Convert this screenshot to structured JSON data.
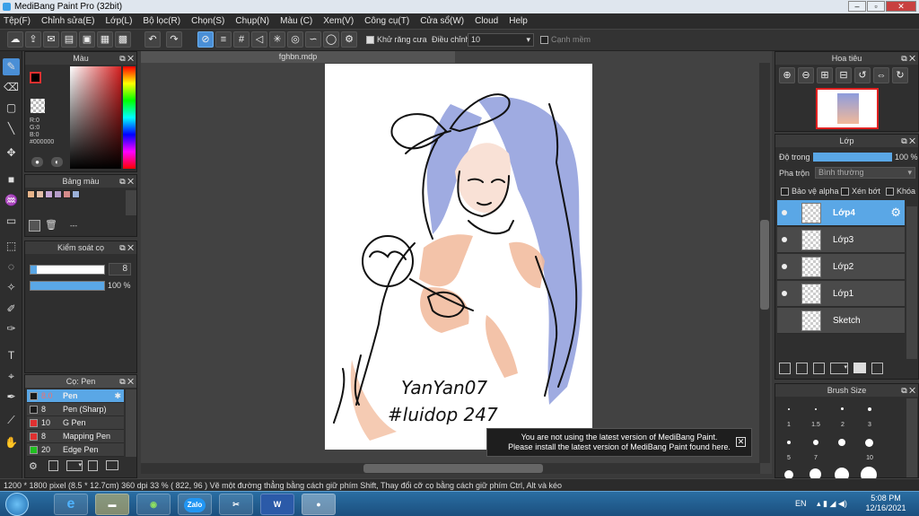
{
  "window": {
    "title": "MediBang Paint Pro (32bit)"
  },
  "menu": [
    "Tệp(F)",
    "Chỉnh sửa(E)",
    "Lớp(L)",
    "Bộ lọc(R)",
    "Chọn(S)",
    "Chụp(N)",
    "Màu (C)",
    "Xem(V)",
    "Công cụ(T)",
    "Cửa sổ(W)",
    "Cloud",
    "Help"
  ],
  "toolbar": {
    "antialias_label": "Khử răng cưa",
    "adjust_label": "Điều chỉnh",
    "adjust_value": "10",
    "edge_label": "Cạnh mềm"
  },
  "color_panel": {
    "title": "Màu",
    "r": "R:0",
    "g": "G:0",
    "b": "B:0",
    "hex": "#000000",
    "fg": "#000000",
    "bg": "#ffffff"
  },
  "palette_panel": {
    "title": "Bảng màu",
    "swatches": [
      "#e8b48a",
      "#e2bda8",
      "#c7a8d6",
      "#b59cc8",
      "#d58a8a",
      "#9ab0d8"
    ],
    "dash_label": "---"
  },
  "brush_control": {
    "title": "Kiểm soát cọ",
    "size_value": "8",
    "opacity_value": "100 %",
    "size_level_pct": 8,
    "opacity_level_pct": 100
  },
  "brush_panel": {
    "title": "Cọ: Pen",
    "items": [
      {
        "size": "8.0",
        "name": "Pen",
        "color": "#1a1a1a"
      },
      {
        "size": "8",
        "name": "Pen (Sharp)",
        "color": "#1a1a1a"
      },
      {
        "size": "10",
        "name": "G Pen",
        "color": "#e03030"
      },
      {
        "size": "8",
        "name": "Mapping Pen",
        "color": "#e03030"
      },
      {
        "size": "20",
        "name": "Edge Pen",
        "color": "#20c020"
      }
    ]
  },
  "document": {
    "tab": "fghbn.mdp",
    "sig1": "YanYan07",
    "sig2": "#luidop 247"
  },
  "navigator": {
    "title": "Hoa tiêu"
  },
  "layer_panel": {
    "title": "Lớp",
    "opacity_label": "Độ trong",
    "opacity_value": "100 %",
    "opacity_level_pct": 100,
    "blend_label": "Pha trộn",
    "blend_value": "Bình thường",
    "protect_alpha": "Bảo vệ alpha",
    "clip": "Xén bớt",
    "lock": "Khóa",
    "layers": [
      "Lớp4",
      "Lớp3",
      "Lớp2",
      "Lớp1",
      "Sketch"
    ]
  },
  "brush_size_panel": {
    "title": "Brush Size",
    "sizes": [
      "1",
      "1.5",
      "2",
      "3",
      "5",
      "7",
      "10"
    ]
  },
  "notification": {
    "line1": "You are not using the latest version of MediBang Paint.",
    "line2": "Please install the latest version of MediBang Paint found here."
  },
  "status": {
    "text": "1200 * 1800 pixel  (8.5 * 12.7cm)  360 dpi  33 %  ( 822, 96 )  Vẽ một đường thẳng bằng cách giữ phím Shift, Thay đổi cỡ cọ bằng cách giữ phím Ctrl, Alt và kéo"
  },
  "taskbar": {
    "lang": "EN",
    "time": "5:08 PM",
    "date": "12/16/2021",
    "zalo": "Zalo"
  },
  "colors": {
    "accent": "#5aa7e6",
    "hair": "#8a9ad8",
    "skin": "#f1b99a"
  }
}
